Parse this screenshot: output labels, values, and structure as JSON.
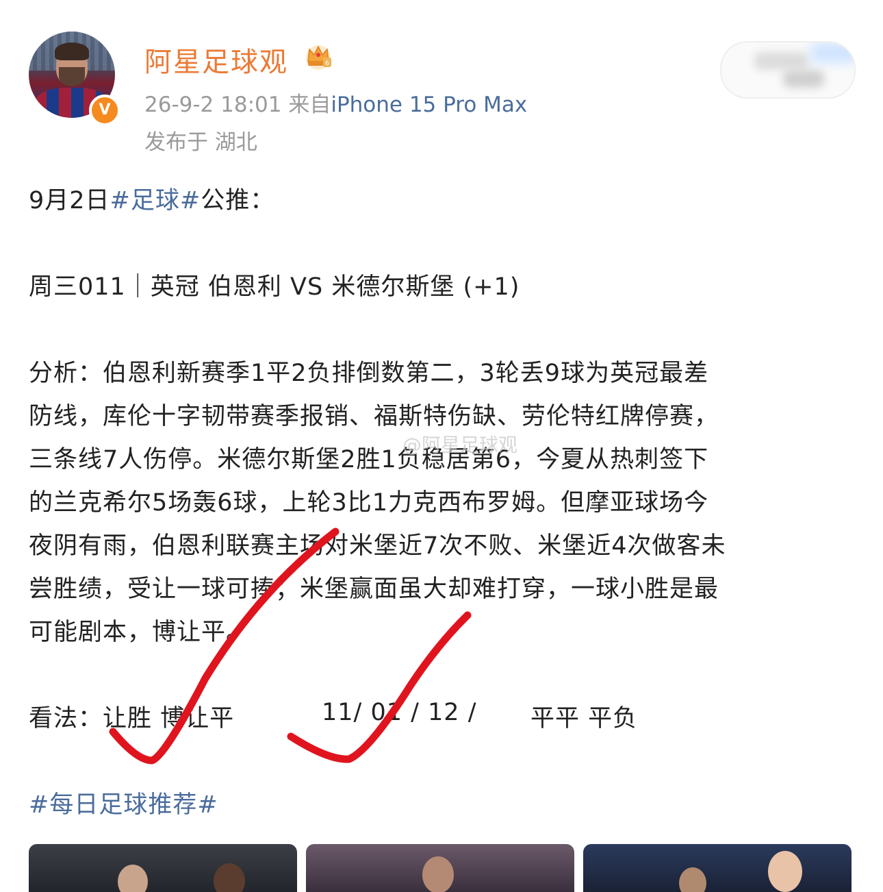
{
  "post": {
    "username": "阿星足球观",
    "time": "26-9-2 18:01",
    "from_prefix": "来自",
    "device": "iPhone 15 Pro Max",
    "location": "发布于 湖北",
    "verified_badge": "V",
    "icons": {
      "vip": "crown-icon",
      "verified": "verified-badge-icon"
    }
  },
  "content": {
    "line1_prefix": "9月2日",
    "line1_tag": "#足球#",
    "line1_suffix": "公推：",
    "match": "周三011｜英冠 伯恩利 VS 米德尔斯堡 (+1)",
    "analysis": [
      "分析：伯恩利新赛季1平2负排倒数第二，3轮丢9球为英冠最差",
      "防线，库伦十字韧带赛季报销、福斯特伤缺、劳伦特红牌停赛，",
      "三条线7人伤停。米德尔斯堡2胜1负稳居第6，今夏从热刺签下",
      "的兰克希尔5场轰6球，上轮3比1力克西布罗姆。但摩亚球场今",
      "夜阴有雨，伯恩利联赛主场对米堡近7次不败、米堡近4次做客未",
      "尝胜绩，受让一球可捧；米堡赢面虽大却难打穿，一球小胜是最",
      "可能剧本，博让平。"
    ],
    "view_label": "看法：",
    "view_pick": "让胜 博让平",
    "view_scores": "11/ 01 / 12 /",
    "view_halftime": "平平 平负",
    "hashtag": "#每日足球推荐#",
    "watermark": "@阿星足球观"
  },
  "colors": {
    "username": "#eb7a35",
    "link": "#4a6c9c",
    "meta": "#9a9a9a",
    "check": "#e0141e"
  }
}
